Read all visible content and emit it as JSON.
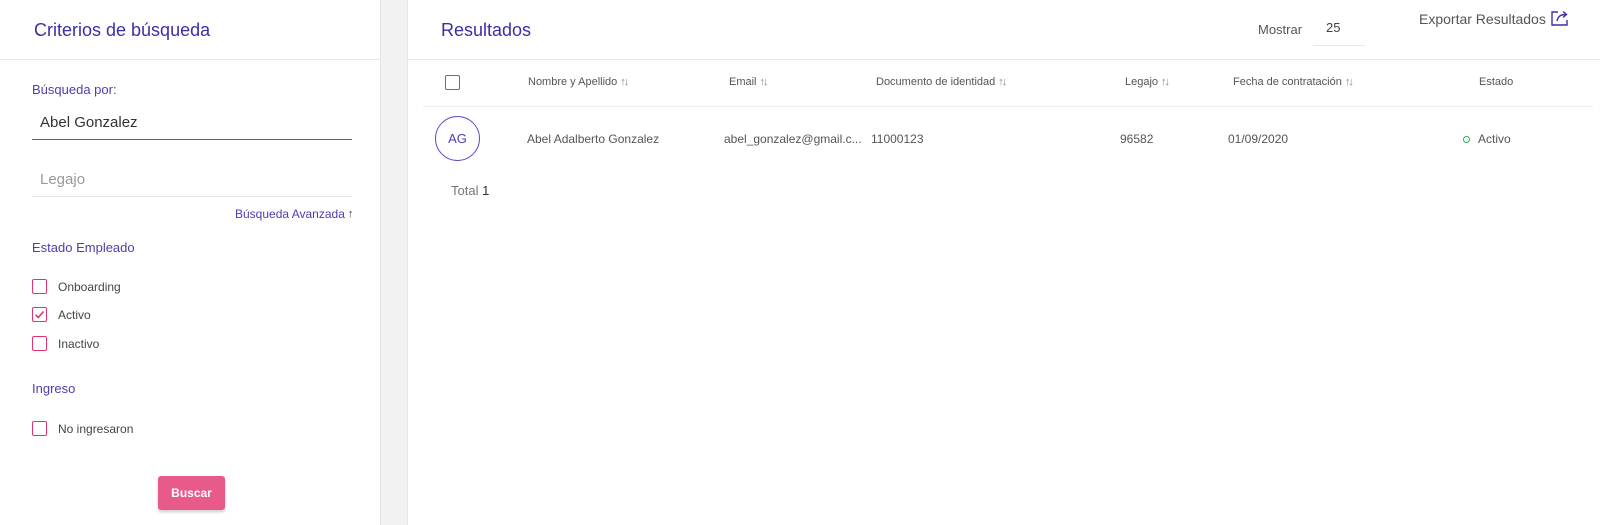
{
  "left_panel": {
    "title": "Criterios de búsqueda",
    "search_label": "Búsqueda por:",
    "search_value": "Abel Gonzalez",
    "legajo_placeholder": "Legajo",
    "advanced_link": "Búsqueda Avanzada",
    "estado_title": "Estado Empleado",
    "estado_options": [
      {
        "label": "Onboarding",
        "checked": false
      },
      {
        "label": "Activo",
        "checked": true
      },
      {
        "label": "Inactivo",
        "checked": false
      }
    ],
    "ingreso_title": "Ingreso",
    "ingreso_options": [
      {
        "label": "No ingresaron",
        "checked": false
      }
    ],
    "search_button": "Buscar"
  },
  "results": {
    "title": "Resultados",
    "show_label": "Mostrar",
    "show_value": "25",
    "export_label": "Exportar Resultados",
    "columns": [
      "Nombre y Apellido",
      "Email",
      "Documento de identidad",
      "Legajo",
      "Fecha de contratación",
      "Estado"
    ],
    "rows": [
      {
        "initials": "AG",
        "name": "Abel Adalberto Gonzalez",
        "email": "abel_gonzalez@gmail.c...",
        "document": "11000123",
        "legajo": "96582",
        "hire_date": "01/09/2020",
        "status": "Activo"
      }
    ],
    "total_label": "Total",
    "total_count": "1"
  },
  "colors": {
    "accent": "#3b2fa8",
    "checkbox_border": "#e0336f",
    "button": "#e85a8a",
    "status_active": "#27ae60"
  },
  "icons": {
    "sort": "sort-arrows-icon",
    "export": "export-icon",
    "advanced": "arrow-up-icon",
    "check": "check-icon"
  }
}
